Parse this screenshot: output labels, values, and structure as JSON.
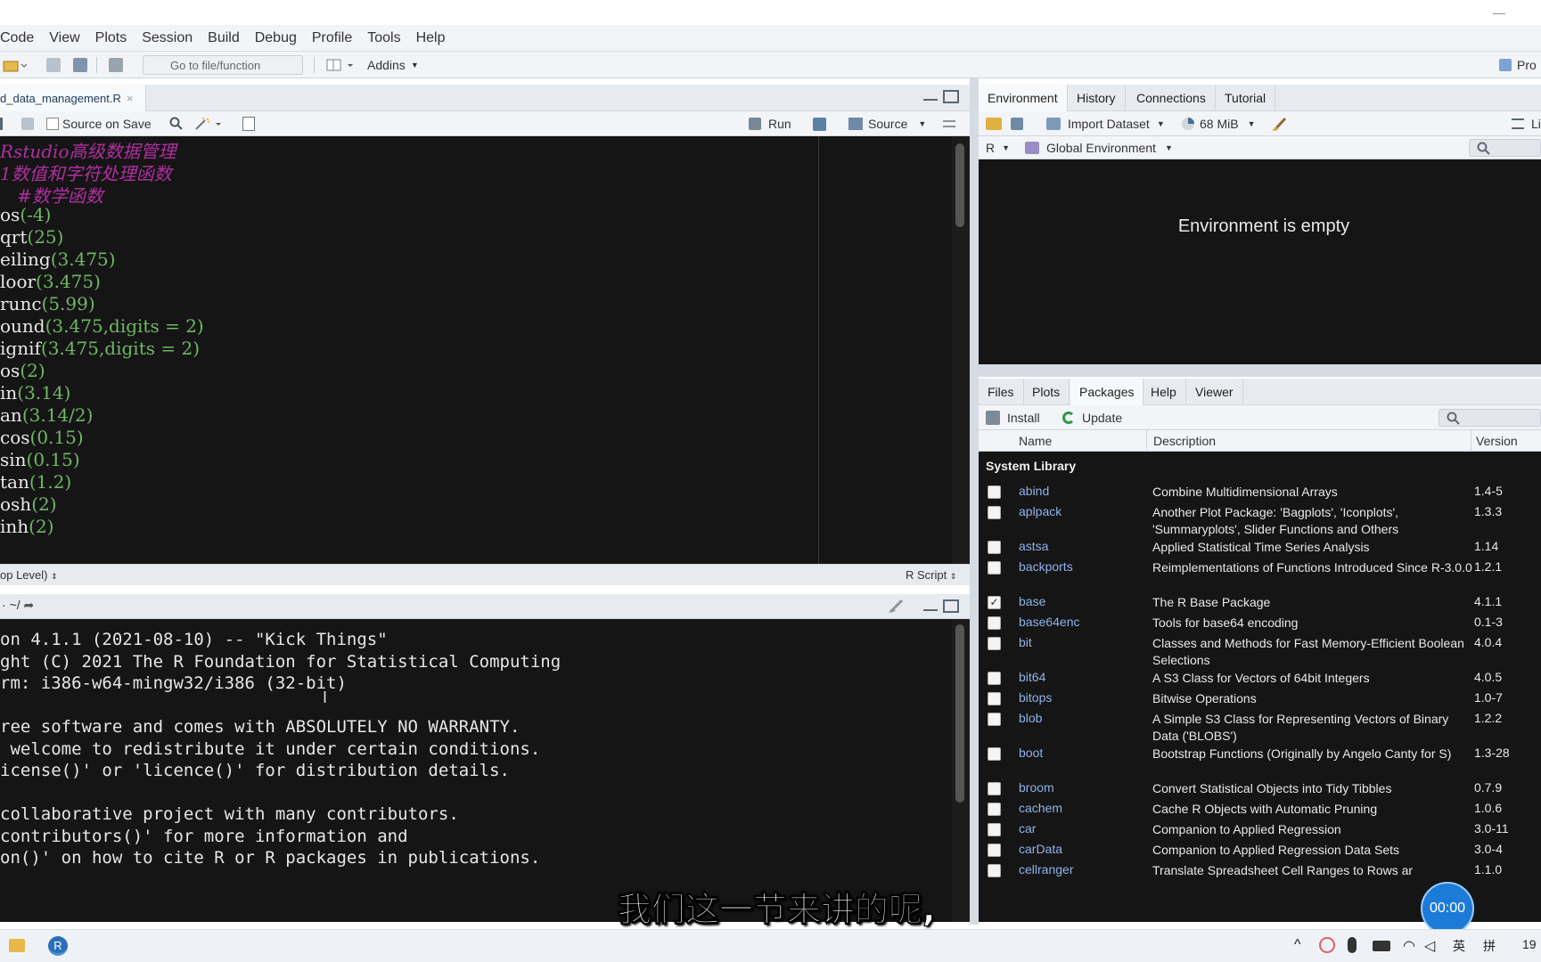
{
  "menu": [
    "Code",
    "View",
    "Plots",
    "Session",
    "Build",
    "Debug",
    "Profile",
    "Tools",
    "Help"
  ],
  "toolbar": {
    "goto_placeholder": "Go to file/function",
    "addins": "Addins",
    "project": "Pro"
  },
  "editor": {
    "file_tab": "d_data_management.R",
    "source_on_save": "Source on Save",
    "run": "Run",
    "source": "Source",
    "status_left": "op Level)",
    "status_right": "R Script",
    "lines": [
      {
        "type": "comment",
        "text": "Rstudio高级数据管理"
      },
      {
        "type": "comment",
        "text": "1数值和字符处理函数"
      },
      {
        "type": "comment",
        "text": "   #数学函数"
      },
      {
        "type": "code",
        "fn": "os",
        "args": "(-4)"
      },
      {
        "type": "code",
        "fn": "qrt",
        "args": "(25)"
      },
      {
        "type": "code",
        "fn": "eiling",
        "args": "(3.475)"
      },
      {
        "type": "code",
        "fn": "loor",
        "args": "(3.475)"
      },
      {
        "type": "code",
        "fn": "runc",
        "args": "(5.99)"
      },
      {
        "type": "code",
        "fn": "ound",
        "args": "(3.475,digits = 2)"
      },
      {
        "type": "code",
        "fn": "ignif",
        "args": "(3.475,digits = 2)"
      },
      {
        "type": "code",
        "fn": "os",
        "args": "(2)"
      },
      {
        "type": "code",
        "fn": "in",
        "args": "(3.14)"
      },
      {
        "type": "code",
        "fn": "an",
        "args": "(3.14/2)"
      },
      {
        "type": "code",
        "fn": "cos",
        "args": "(0.15)"
      },
      {
        "type": "code",
        "fn": "sin",
        "args": "(0.15)"
      },
      {
        "type": "code",
        "fn": "tan",
        "args": "(1.2)"
      },
      {
        "type": "code",
        "fn": "osh",
        "args": "(2)"
      },
      {
        "type": "code",
        "fn": "inh",
        "args": "(2)"
      }
    ]
  },
  "console": {
    "path": "~/",
    "lines": [
      "on 4.1.1 (2021-08-10) -- \"Kick Things\"",
      "ght (C) 2021 The R Foundation for Statistical Computing",
      "rm: i386-w64-mingw32/i386 (32-bit)",
      "",
      "ree software and comes with ABSOLUTELY NO WARRANTY.",
      " welcome to redistribute it under certain conditions.",
      "icense()' or 'licence()' for distribution details.",
      "",
      "collaborative project with many contributors.",
      "contributors()' for more information and",
      "on()' on how to cite R or R packages in publications."
    ]
  },
  "env": {
    "tabs": [
      "Environment",
      "History",
      "Connections",
      "Tutorial"
    ],
    "import_dataset": "Import Dataset",
    "memory": "68 MiB",
    "lang": "R",
    "scope": "Global Environment",
    "empty_message": "Environment is empty",
    "list_label": "Li"
  },
  "packages": {
    "tabs": [
      "Files",
      "Plots",
      "Packages",
      "Help",
      "Viewer"
    ],
    "install": "Install",
    "update": "Update",
    "columns": {
      "name": "Name",
      "description": "Description",
      "version": "Version"
    },
    "section": "System Library",
    "rows": [
      {
        "name": "abind",
        "desc": "Combine Multidimensional Arrays",
        "ver": "1.4-5",
        "checked": false
      },
      {
        "name": "aplpack",
        "desc": "Another Plot Package: 'Bagplots', 'Iconplots', 'Summaryplots', Slider Functions and Others",
        "ver": "1.3.3",
        "checked": false
      },
      {
        "name": "astsa",
        "desc": "Applied Statistical Time Series Analysis",
        "ver": "1.14",
        "checked": false
      },
      {
        "name": "backports",
        "desc": "Reimplementations of Functions Introduced Since R-3.0.0",
        "ver": "1.2.1",
        "checked": false
      },
      {
        "name": "base",
        "desc": "The R Base Package",
        "ver": "4.1.1",
        "checked": true
      },
      {
        "name": "base64enc",
        "desc": "Tools for base64 encoding",
        "ver": "0.1-3",
        "checked": false
      },
      {
        "name": "bit",
        "desc": "Classes and Methods for Fast Memory-Efficient Boolean Selections",
        "ver": "4.0.4",
        "checked": false
      },
      {
        "name": "bit64",
        "desc": "A S3 Class for Vectors of 64bit Integers",
        "ver": "4.0.5",
        "checked": false
      },
      {
        "name": "bitops",
        "desc": "Bitwise Operations",
        "ver": "1.0-7",
        "checked": false
      },
      {
        "name": "blob",
        "desc": "A Simple S3 Class for Representing Vectors of Binary Data ('BLOBS')",
        "ver": "1.2.2",
        "checked": false
      },
      {
        "name": "boot",
        "desc": "Bootstrap Functions (Originally by Angelo Canty for S)",
        "ver": "1.3-28",
        "checked": false
      },
      {
        "name": "broom",
        "desc": "Convert Statistical Objects into Tidy Tibbles",
        "ver": "0.7.9",
        "checked": false
      },
      {
        "name": "cachem",
        "desc": "Cache R Objects with Automatic Pruning",
        "ver": "1.0.6",
        "checked": false
      },
      {
        "name": "car",
        "desc": "Companion to Applied Regression",
        "ver": "3.0-11",
        "checked": false
      },
      {
        "name": "carData",
        "desc": "Companion to Applied Regression Data Sets",
        "ver": "3.0-4",
        "checked": false
      },
      {
        "name": "cellranger",
        "desc": "Translate Spreadsheet Cell Ranges to Rows ar",
        "ver": "1.1.0",
        "checked": false
      }
    ]
  },
  "overlay": {
    "subtitle": "我们这一节来讲的呢,",
    "timer": "00:00"
  },
  "taskbar": {
    "ime": "英",
    "ime2": "拼",
    "clock": "19"
  }
}
